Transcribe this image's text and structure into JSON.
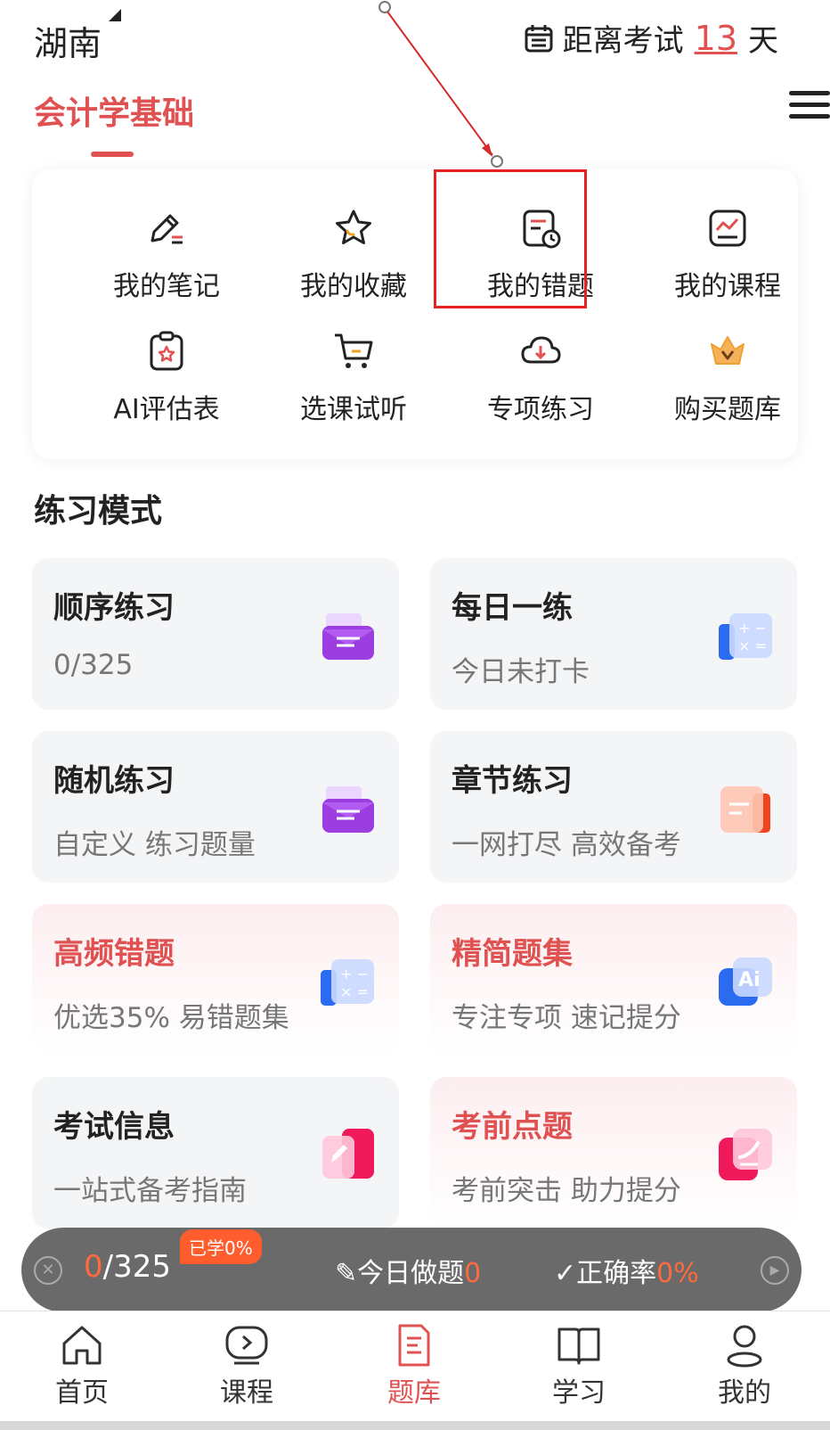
{
  "header": {
    "region": "湖南",
    "exam_prefix": "距离考试",
    "exam_days": "13",
    "exam_suffix": "天",
    "subject": "会计学基础"
  },
  "tools": [
    {
      "label": "我的笔记",
      "icon": "pencil-note-icon"
    },
    {
      "label": "我的收藏",
      "icon": "star-icon"
    },
    {
      "label": "我的错题",
      "icon": "wrong-questions-icon"
    },
    {
      "label": "我的课程",
      "icon": "course-chart-icon"
    },
    {
      "label": "AI评估表",
      "icon": "clipboard-star-icon"
    },
    {
      "label": "选课试听",
      "icon": "cart-icon"
    },
    {
      "label": "专项练习",
      "icon": "cloud-download-icon"
    },
    {
      "label": "购买题库",
      "icon": "crown-icon"
    }
  ],
  "section_title": "练习模式",
  "modes": [
    {
      "title": "顺序练习",
      "sub": "0/325",
      "icon": "envelope-icon"
    },
    {
      "title": "每日一练",
      "sub": "今日未打卡",
      "icon": "calculator-icon"
    },
    {
      "title": "随机练习",
      "sub": "自定义 练习题量",
      "icon": "envelope-icon"
    },
    {
      "title": "章节练习",
      "sub": "一网打尽 高效备考",
      "icon": "book-icon"
    },
    {
      "title": "高频错题",
      "sub": "优选35% 易错题集",
      "icon": "calculator-icon"
    },
    {
      "title": "精简题集",
      "sub": "专注专项 速记提分",
      "icon": "ai-icon"
    },
    {
      "title": "考试信息",
      "sub": "一站式备考指南",
      "icon": "edit-card-icon"
    },
    {
      "title": "考前点题",
      "sub": "考前突击 助力提分",
      "icon": "check-card-icon"
    }
  ],
  "progress": {
    "current": "0",
    "total": "/325",
    "badge": "已学0%",
    "today_label": "今日做题",
    "today_value": "0",
    "accuracy_label": "正确率",
    "accuracy_value": "0%"
  },
  "nav": [
    {
      "label": "首页",
      "icon": "home-icon"
    },
    {
      "label": "课程",
      "icon": "play-screen-icon"
    },
    {
      "label": "题库",
      "icon": "question-bank-icon"
    },
    {
      "label": "学习",
      "icon": "open-book-icon"
    },
    {
      "label": "我的",
      "icon": "user-icon"
    }
  ],
  "colors": {
    "accent": "#e05252",
    "highlight": "#e52222",
    "progress_value": "#ff6a3d"
  }
}
